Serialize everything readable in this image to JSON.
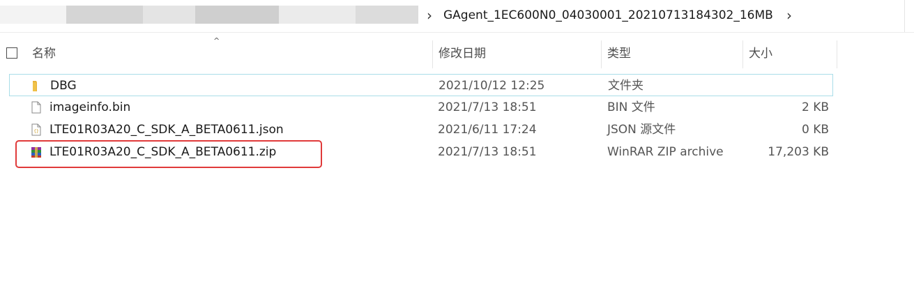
{
  "address": {
    "current_folder": "GAgent_1EC600N0_04030001_20210713184302_16MB"
  },
  "columns": {
    "name": "名称",
    "date": "修改日期",
    "type": "类型",
    "size": "大小"
  },
  "files": [
    {
      "name": "DBG",
      "date": "2021/10/12 12:25",
      "type": "文件夹",
      "size": "",
      "icon": "folder-icon"
    },
    {
      "name": "imageinfo.bin",
      "date": "2021/7/13 18:51",
      "type": "BIN 文件",
      "size": "2 KB",
      "icon": "file-icon"
    },
    {
      "name": "LTE01R03A20_C_SDK_A_BETA0611.json",
      "date": "2021/6/11 17:24",
      "type": "JSON 源文件",
      "size": "0 KB",
      "icon": "json-file-icon"
    },
    {
      "name": "LTE01R03A20_C_SDK_A_BETA0611.zip",
      "date": "2021/7/13 18:51",
      "type": "WinRAR ZIP archive",
      "size": "17,203 KB",
      "icon": "winrar-zip-icon"
    }
  ],
  "colors": {
    "highlight": "#e03a3a",
    "selection_border": "#a9dde8",
    "folder": "#f0c24a"
  }
}
